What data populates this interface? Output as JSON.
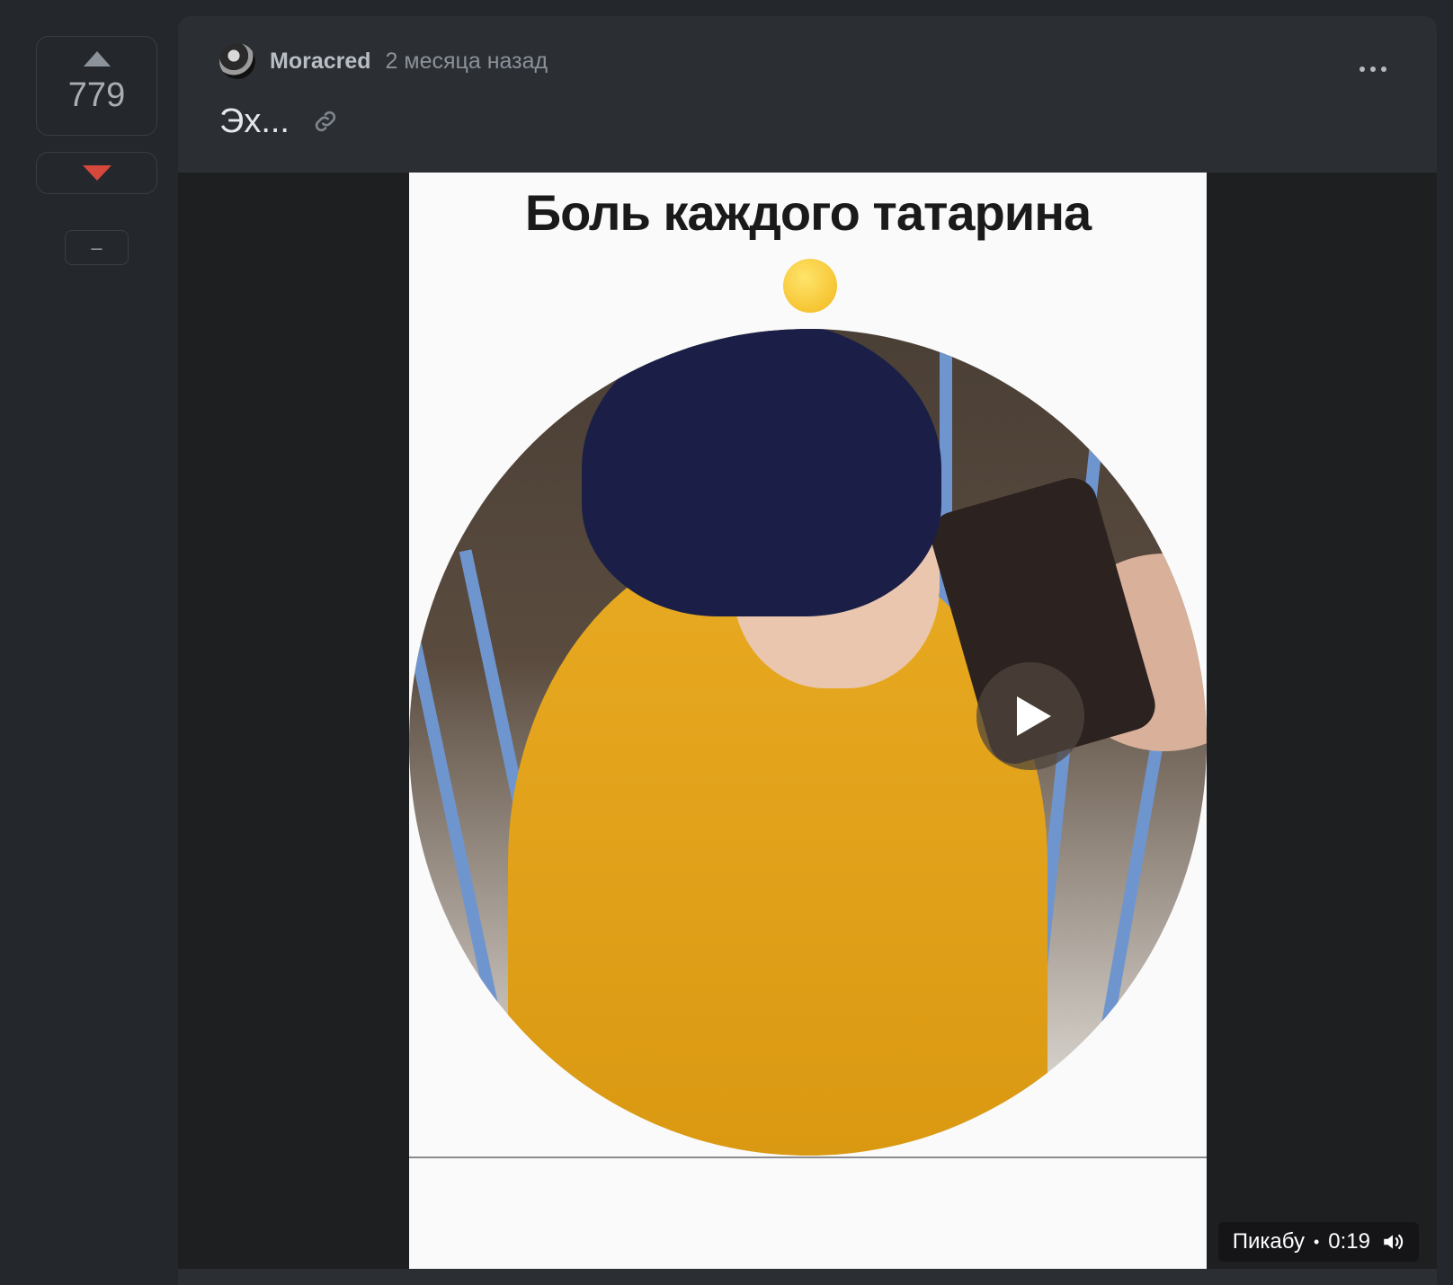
{
  "vote": {
    "rating": "779",
    "collapse_label": "–"
  },
  "post": {
    "author": "Moracred",
    "time": "2 месяца назад",
    "title": "Эх..."
  },
  "video": {
    "caption": "Боль каждого татарина",
    "emoji": "🤣",
    "source": "Пикабу",
    "separator": "•",
    "duration": "0:19"
  },
  "colors": {
    "upvote": "#8d939b",
    "downvote": "#d6473c",
    "jacket": "#e8aa22",
    "hat": "#1b1f47"
  },
  "icons": [
    "upvote-arrow-icon",
    "downvote-arrow-icon",
    "link-icon",
    "more-dots-icon",
    "play-icon",
    "volume-icon"
  ]
}
